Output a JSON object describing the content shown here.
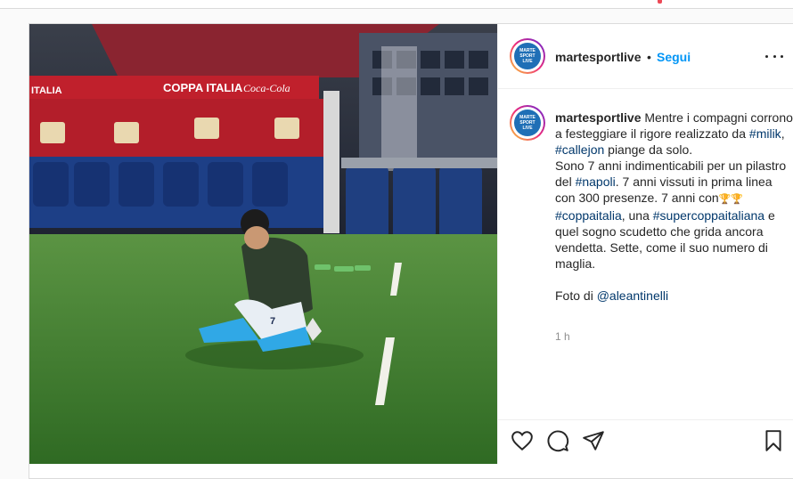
{
  "account": {
    "username": "martesportlive",
    "follow_label": "Segui",
    "separator": "•",
    "logo_lines": [
      "MARTE",
      "SPORT",
      "LIVE"
    ]
  },
  "photo": {
    "banner_text": "COPPA ITALIA",
    "banner_brand": "Coca-Cola",
    "banner_left": "ITALIA",
    "jersey_number": "7"
  },
  "caption": {
    "username": "martesportlive",
    "t1": " Mentre i compagni corrono a festeggiare il rigore realizzato da ",
    "tag_milik": "#milik",
    "t2": ", ",
    "tag_callejon": "#callejon",
    "t3": " piange da solo.",
    "t4": "Sono 7 anni indimenticabili per un pilastro del ",
    "tag_napoli": "#napoli",
    "t5": ". 7 anni vissuti in prima linea con 300 presenze. 7 anni con",
    "trophies": "🏆🏆",
    "t6": " ",
    "tag_coppa": "#coppaitalia",
    "t7": ", una ",
    "tag_super": "#supercoppaitaliana",
    "t8": " e quel sogno scudetto che grida ancora vendetta. Sette, come il suo numero di maglia.",
    "t9": "Foto di ",
    "mention": "@aleantinelli"
  },
  "timestamp": "1 h",
  "icons": [
    "more-icon",
    "heart-icon",
    "comment-icon",
    "share-icon",
    "bookmark-icon"
  ],
  "colors": {
    "link": "#00376b",
    "follow": "#0095f6",
    "text": "#262626",
    "muted": "#8e8e8e"
  }
}
